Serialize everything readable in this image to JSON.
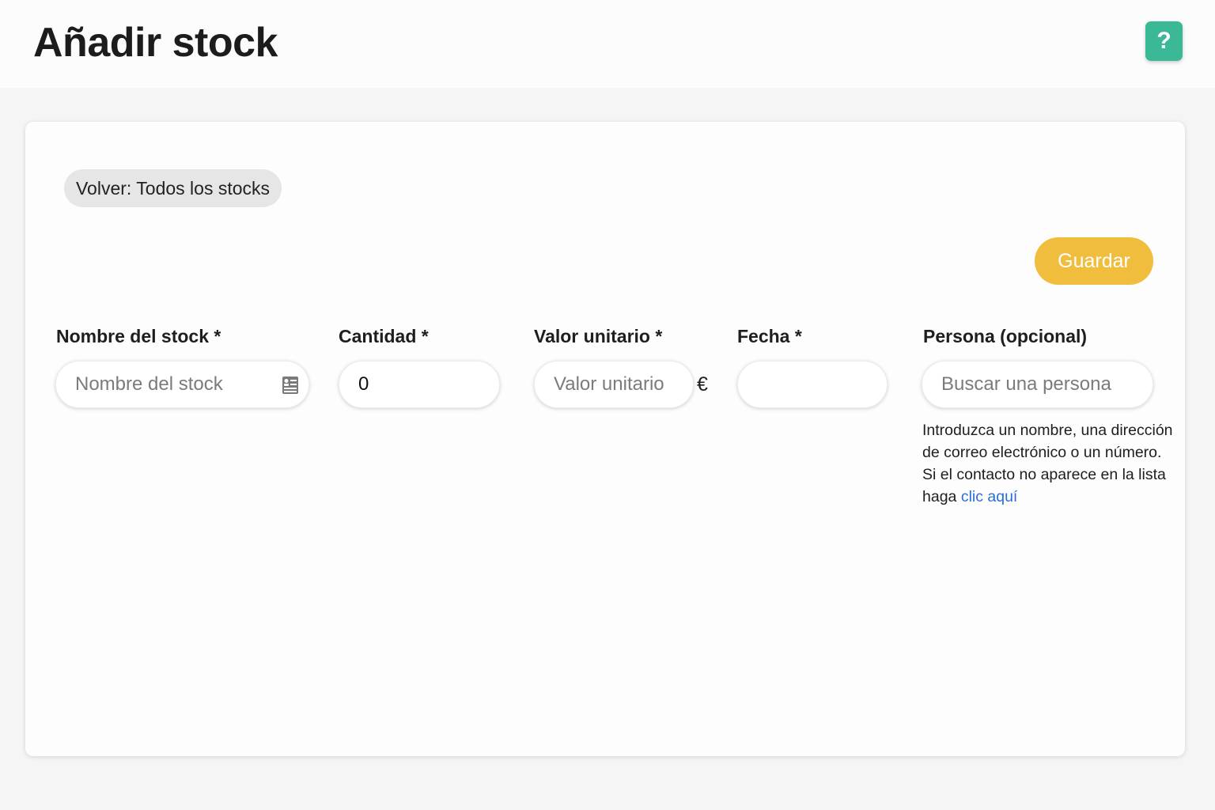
{
  "header": {
    "title": "Añadir stock",
    "help_label": "?"
  },
  "form": {
    "back_label": "Volver: Todos los stocks",
    "save_label": "Guardar",
    "stock_name": {
      "label": "Nombre del stock *",
      "placeholder": "Nombre del stock",
      "value": "",
      "icon": "id-card-icon"
    },
    "quantity": {
      "label": "Cantidad *",
      "value": "0"
    },
    "unit_value": {
      "label": "Valor unitario *",
      "placeholder": "Valor unitario",
      "value": "",
      "currency": "€"
    },
    "date": {
      "label": "Fecha *",
      "value": ""
    },
    "person": {
      "label": "Persona (opcional)",
      "placeholder": "Buscar una persona",
      "value": "",
      "help_text": "Introduzca un nombre, una dirección de correo electrónico o un número. Si el contacto no aparece en la lista haga ",
      "help_link": "clic aquí"
    }
  },
  "colors": {
    "accent_help": "#3bb896",
    "save_button": "#f0bd3d",
    "link": "#2a6fd6"
  }
}
